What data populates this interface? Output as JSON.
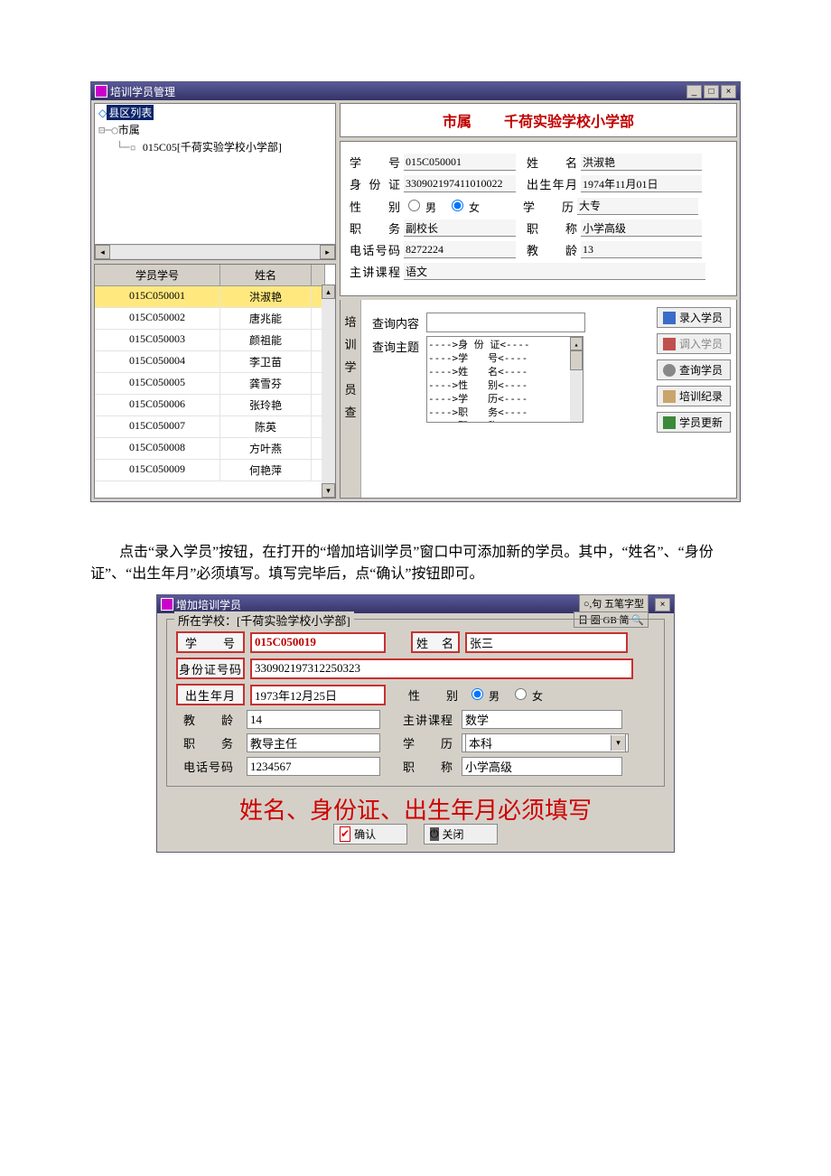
{
  "top_window": {
    "title": "培训学员管理",
    "tree": {
      "root": "县区列表",
      "level1": "市属",
      "level2": "015C05[千荷实验学校小学部]"
    },
    "grid": {
      "headers": {
        "id": "学员学号",
        "name": "姓名"
      },
      "rows": [
        {
          "id": "015C050001",
          "name": "洪淑艳",
          "selected": true
        },
        {
          "id": "015C050002",
          "name": "唐兆能"
        },
        {
          "id": "015C050003",
          "name": "颜祖能"
        },
        {
          "id": "015C050004",
          "name": "李卫苗"
        },
        {
          "id": "015C050005",
          "name": "龚雪芬"
        },
        {
          "id": "015C050006",
          "name": "张玲艳"
        },
        {
          "id": "015C050007",
          "name": "陈英"
        },
        {
          "id": "015C050008",
          "name": "方叶燕"
        },
        {
          "id": "015C050009",
          "name": "何艳萍"
        }
      ]
    },
    "header": {
      "left": "市属",
      "right": "千荷实验学校小学部"
    },
    "detail": {
      "labels": {
        "student_no": "学　　号",
        "name": "姓　　名",
        "id_card": "身 份 证",
        "birth": "出生年月",
        "gender": "性　　别",
        "edu": "学　　历",
        "duty": "职　　务",
        "title": "职　　称",
        "phone": "电话号码",
        "years": "教　　龄",
        "course": "主讲课程"
      },
      "values": {
        "student_no": "015C050001",
        "name": "洪淑艳",
        "id_card": "330902197411010022",
        "birth": "1974年11月01日",
        "gender_male": "男",
        "gender_female": "女",
        "gender_selected": "女",
        "edu": "大专",
        "duty": "副校长",
        "title": "小学高级",
        "phone": "8272224",
        "years": "13",
        "course": "语文"
      }
    },
    "search": {
      "vtab": [
        "培",
        "训",
        "学",
        "员",
        "查"
      ],
      "content_label": "查询内容",
      "topic_label": "查询主题",
      "topics": [
        "---->身 份 证<----",
        "---->学　　号<----",
        "---->姓　　名<----",
        "---->性　　别<----",
        "---->学　　历<----",
        "---->职　　务<----",
        "---->职　　称<----"
      ],
      "buttons": {
        "add": "录入学员",
        "import": "调入学员",
        "query": "查询学员",
        "record": "培训纪录",
        "refresh": "学员更新"
      }
    }
  },
  "paragraph": "点击“录入学员”按钮，在打开的“增加培训学员”窗口中可添加新的学员。其中，“姓名”、“身份证”、“出生年月”必须填写。填写完毕后，点“确认”按钮即可。",
  "dialog": {
    "title": "增加培训学员",
    "ime": "○,句 五笔字型",
    "ime2": "日 圈 GB 简 🔍",
    "fieldset_legend": "所在学校：[千荷实验学校小学部]",
    "labels": {
      "student_no": "学　　号",
      "name": "姓　名",
      "id_card": "身份证号码",
      "birth": "出生年月",
      "gender": "性　　别",
      "years": "教　　龄",
      "course": "主讲课程",
      "duty": "职　　务",
      "edu": "学　　历",
      "phone": "电话号码",
      "title": "职　　称"
    },
    "values": {
      "student_no": "015C050019",
      "name": "张三",
      "id_card": "330902197312250323",
      "birth": "1973年12月25日",
      "gender_male": "男",
      "gender_female": "女",
      "years": "14",
      "course": "数学",
      "duty": "教导主任",
      "edu": "本科",
      "phone": "1234567",
      "title": "小学高级"
    },
    "note": "姓名、身份证、出生年月必须填写",
    "buttons": {
      "ok": "确认",
      "close": "关闭"
    }
  }
}
